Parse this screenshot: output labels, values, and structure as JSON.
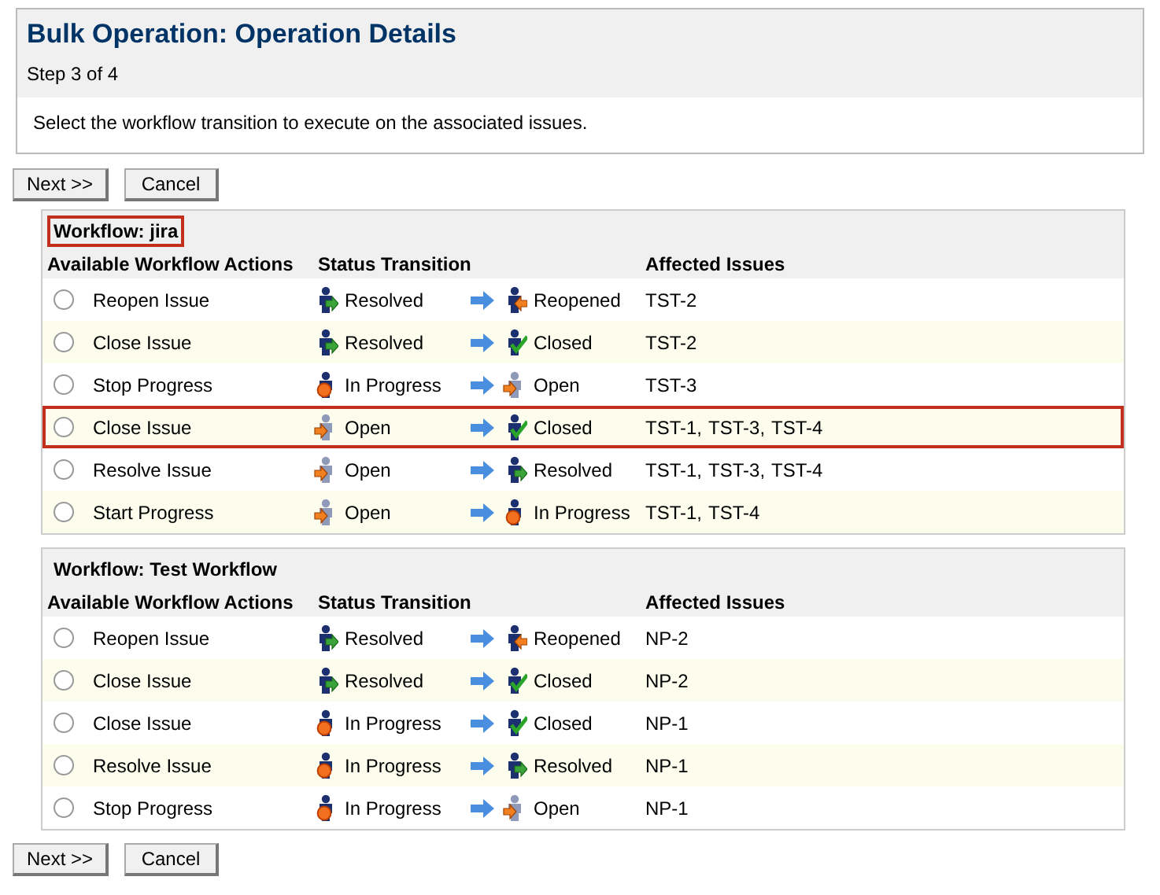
{
  "header": {
    "title": "Bulk Operation: Operation Details",
    "step": "Step 3 of 4",
    "instructions": "Select the workflow transition to execute on the associated issues."
  },
  "buttons_top": [
    "Next >>",
    "Cancel"
  ],
  "workflows": [
    {
      "title": "Workflow: jira",
      "highlighted": true,
      "columns": [
        "Available Workflow Actions",
        "Status Transition",
        "Affected Issues"
      ],
      "rows": [
        {
          "action": "Reopen Issue",
          "selected": false,
          "highlighted": false,
          "from": {
            "label": "Resolved",
            "kind": "resolved"
          },
          "to": {
            "label": "Reopened",
            "kind": "reopened"
          },
          "issues": [
            "TST-2"
          ]
        },
        {
          "action": "Close Issue",
          "selected": false,
          "highlighted": false,
          "from": {
            "label": "Resolved",
            "kind": "resolved"
          },
          "to": {
            "label": "Closed",
            "kind": "closed"
          },
          "issues": [
            "TST-2"
          ]
        },
        {
          "action": "Stop Progress",
          "selected": false,
          "highlighted": false,
          "from": {
            "label": "In Progress",
            "kind": "inprogress"
          },
          "to": {
            "label": "Open",
            "kind": "open"
          },
          "issues": [
            "TST-3"
          ]
        },
        {
          "action": "Close Issue",
          "selected": false,
          "highlighted": true,
          "from": {
            "label": "Open",
            "kind": "open"
          },
          "to": {
            "label": "Closed",
            "kind": "closed"
          },
          "issues": [
            "TST-1,",
            "TST-3,",
            "TST-4"
          ]
        },
        {
          "action": "Resolve Issue",
          "selected": false,
          "highlighted": false,
          "from": {
            "label": "Open",
            "kind": "open"
          },
          "to": {
            "label": "Resolved",
            "kind": "resolved"
          },
          "issues": [
            "TST-1,",
            "TST-3,",
            "TST-4"
          ]
        },
        {
          "action": "Start Progress",
          "selected": false,
          "highlighted": false,
          "from": {
            "label": "Open",
            "kind": "open"
          },
          "to": {
            "label": "In Progress",
            "kind": "inprogress"
          },
          "issues": [
            "TST-1,",
            "TST-4"
          ]
        }
      ]
    },
    {
      "title": "Workflow: Test Workflow",
      "highlighted": false,
      "columns": [
        "Available Workflow Actions",
        "Status Transition",
        "Affected Issues"
      ],
      "rows": [
        {
          "action": "Reopen Issue",
          "selected": false,
          "highlighted": false,
          "from": {
            "label": "Resolved",
            "kind": "resolved"
          },
          "to": {
            "label": "Reopened",
            "kind": "reopened"
          },
          "issues": [
            "NP-2"
          ]
        },
        {
          "action": "Close Issue",
          "selected": false,
          "highlighted": false,
          "from": {
            "label": "Resolved",
            "kind": "resolved"
          },
          "to": {
            "label": "Closed",
            "kind": "closed"
          },
          "issues": [
            "NP-2"
          ]
        },
        {
          "action": "Close Issue",
          "selected": false,
          "highlighted": false,
          "from": {
            "label": "In Progress",
            "kind": "inprogress"
          },
          "to": {
            "label": "Closed",
            "kind": "closed"
          },
          "issues": [
            "NP-1"
          ]
        },
        {
          "action": "Resolve Issue",
          "selected": false,
          "highlighted": false,
          "from": {
            "label": "In Progress",
            "kind": "inprogress"
          },
          "to": {
            "label": "Resolved",
            "kind": "resolved"
          },
          "issues": [
            "NP-1"
          ]
        },
        {
          "action": "Stop Progress",
          "selected": false,
          "highlighted": false,
          "from": {
            "label": "In Progress",
            "kind": "inprogress"
          },
          "to": {
            "label": "Open",
            "kind": "open"
          },
          "issues": [
            "NP-1"
          ]
        }
      ]
    }
  ],
  "buttons_bottom": [
    "Next >>",
    "Cancel"
  ]
}
